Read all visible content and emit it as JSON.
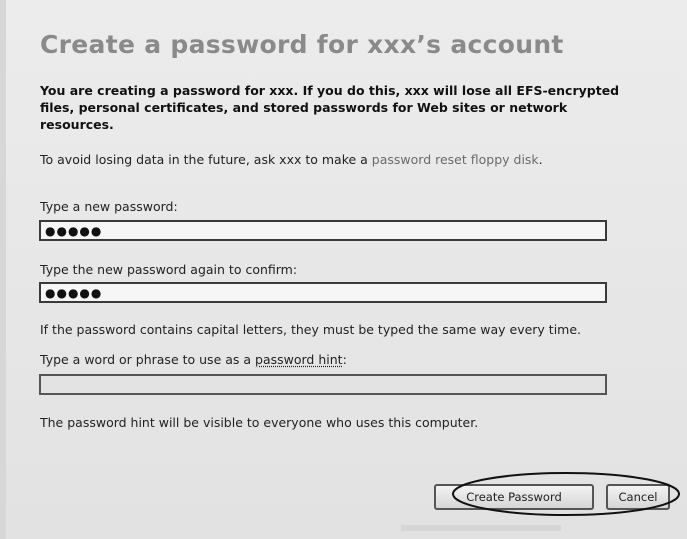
{
  "dialog": {
    "title": "Create a password for xxx’s account",
    "warning": "You are creating a password for xxx. If you do this, xxx will lose all EFS-encrypted files, personal certificates, and stored passwords for Web sites or network resources.",
    "avoid_text": "To avoid losing data in the future, ask xxx to make a ",
    "avoid_link": "password reset floppy disk",
    "avoid_end": ".",
    "new_password_label": "Type a new password:",
    "new_password_value": "●●●●●",
    "confirm_label": "Type the new password again to confirm:",
    "confirm_value": "●●●●●",
    "caps_note": "If the password contains capital letters, they must be typed the same way every time.",
    "hint_label_prefix": "Type a word or phrase to use as a ",
    "hint_label_link": "password hint",
    "hint_label_suffix": ":",
    "hint_value": "",
    "hint_visibility_note": "The password hint will be visible to everyone who uses this computer."
  },
  "buttons": {
    "create_label": "Create Password",
    "cancel_label": "Cancel"
  }
}
